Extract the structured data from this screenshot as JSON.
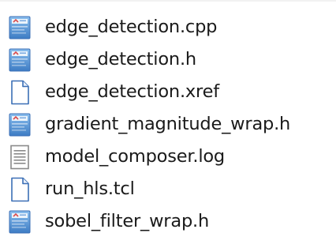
{
  "files": [
    {
      "name": "edge_detection.cpp",
      "icon": "code-file-icon"
    },
    {
      "name": "edge_detection.h",
      "icon": "code-file-icon"
    },
    {
      "name": "edge_detection.xref",
      "icon": "blank-file-icon"
    },
    {
      "name": "gradient_magnitude_wrap.h",
      "icon": "code-file-icon"
    },
    {
      "name": "model_composer.log",
      "icon": "text-file-icon"
    },
    {
      "name": "run_hls.tcl",
      "icon": "blank-file-icon"
    },
    {
      "name": "sobel_filter_wrap.h",
      "icon": "code-file-icon"
    }
  ],
  "colors": {
    "code_icon_top": "#7ab4ea",
    "code_icon_bottom": "#3f7fc7",
    "code_icon_mark": "#d94b4b",
    "blank_icon_border": "#3b6fb6",
    "text_icon_border": "#8a8a8a"
  }
}
